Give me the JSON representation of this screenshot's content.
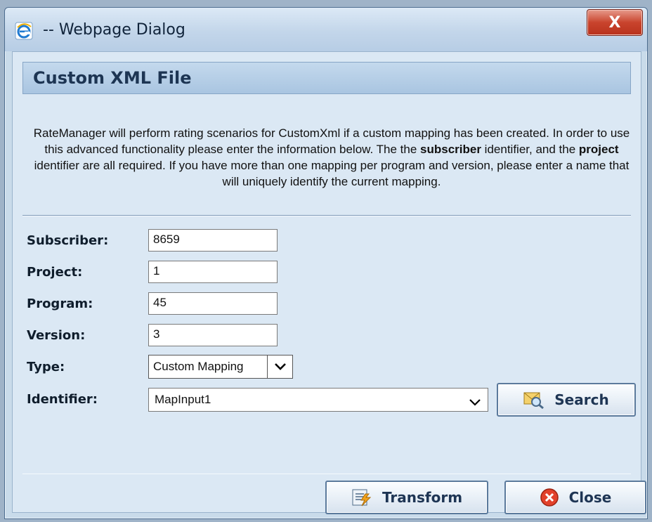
{
  "window": {
    "title": "-- Webpage Dialog",
    "close_glyph": "X"
  },
  "header": {
    "title": "Custom XML File"
  },
  "description": {
    "part1": "RateManager will perform rating scenarios for CustomXml if a custom mapping has been created. In order to use this advanced functionality please enter the information below. The the ",
    "bold1": "subscriber",
    "part2": " identifier, and the ",
    "bold2": "project",
    "part3": " identifier are all required. If you have more than one mapping per program and version, please enter a name that will uniquely identify the current mapping."
  },
  "form": {
    "subscriber_label": "Subscriber:",
    "subscriber_value": "8659",
    "project_label": "Project:",
    "project_value": "1",
    "program_label": "Program:",
    "program_value": "45",
    "version_label": "Version:",
    "version_value": "3",
    "type_label": "Type:",
    "type_value": "Custom Mapping",
    "identifier_label": "Identifier:",
    "identifier_value": "MapInput1"
  },
  "buttons": {
    "search": "Search",
    "transform": "Transform",
    "close": "Close"
  },
  "icons": {
    "window": "ie-icon",
    "search": "envelope-magnifier-icon",
    "transform": "transform-icon",
    "close": "close-circle-icon"
  },
  "colors": {
    "header_band": "#a9c5e1",
    "client_bg": "#dbe8f4",
    "close_button": "#c9442d"
  }
}
